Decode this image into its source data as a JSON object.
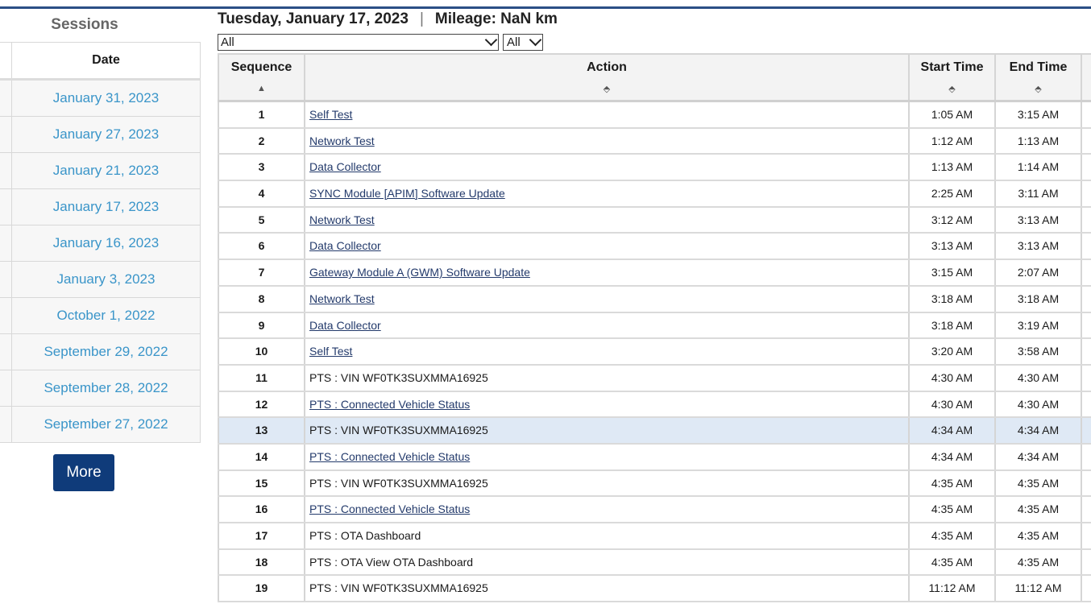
{
  "sessions": {
    "title": "Sessions",
    "date_header": "Date",
    "dates": [
      "January 31, 2023",
      "January 27, 2023",
      "January 21, 2023",
      "January 17, 2023",
      "January 16, 2023",
      "January 3, 2023",
      "October 1, 2022",
      "September 29, 2022",
      "September 28, 2022",
      "September 27, 2022"
    ],
    "more_label": "More"
  },
  "header": {
    "date": "Tuesday, January 17, 2023",
    "separator": "|",
    "mileage": "Mileage: NaN km"
  },
  "filters": {
    "action_filter": "All",
    "type_filter": "All"
  },
  "table": {
    "columns": {
      "sequence": "Sequence",
      "action": "Action",
      "start": "Start Time",
      "end": "End Time"
    },
    "sort_icons": {
      "sequence": "▲",
      "action": "⬘",
      "start": "⬘",
      "end": "⬘"
    },
    "rows": [
      {
        "seq": "1",
        "action": "Self Test",
        "link": true,
        "start": "1:05 AM",
        "end": "3:15 AM"
      },
      {
        "seq": "2",
        "action": "Network Test",
        "link": true,
        "start": "1:12 AM",
        "end": "1:13 AM"
      },
      {
        "seq": "3",
        "action": "Data Collector",
        "link": true,
        "start": "1:13 AM",
        "end": "1:14 AM"
      },
      {
        "seq": "4",
        "action": "SYNC Module [APIM] Software Update",
        "link": true,
        "start": "2:25 AM",
        "end": "3:11 AM"
      },
      {
        "seq": "5",
        "action": "Network Test",
        "link": true,
        "start": "3:12 AM",
        "end": "3:13 AM"
      },
      {
        "seq": "6",
        "action": "Data Collector",
        "link": true,
        "start": "3:13 AM",
        "end": "3:13 AM"
      },
      {
        "seq": "7",
        "action": "Gateway Module A (GWM) Software Update",
        "link": true,
        "start": "3:15 AM",
        "end": "2:07 AM"
      },
      {
        "seq": "8",
        "action": "Network Test",
        "link": true,
        "start": "3:18 AM",
        "end": "3:18 AM"
      },
      {
        "seq": "9",
        "action": "Data Collector",
        "link": true,
        "start": "3:18 AM",
        "end": "3:19 AM"
      },
      {
        "seq": "10",
        "action": "Self Test",
        "link": true,
        "start": "3:20 AM",
        "end": "3:58 AM"
      },
      {
        "seq": "11",
        "action": "PTS : VIN WF0TK3SUXMMA16925",
        "link": false,
        "start": "4:30 AM",
        "end": "4:30 AM"
      },
      {
        "seq": "12",
        "action": "PTS : Connected Vehicle Status",
        "link": true,
        "start": "4:30 AM",
        "end": "4:30 AM"
      },
      {
        "seq": "13",
        "action": "PTS : VIN WF0TK3SUXMMA16925",
        "link": false,
        "start": "4:34 AM",
        "end": "4:34 AM",
        "selected": true
      },
      {
        "seq": "14",
        "action": "PTS : Connected Vehicle Status",
        "link": true,
        "start": "4:34 AM",
        "end": "4:34 AM"
      },
      {
        "seq": "15",
        "action": "PTS : VIN WF0TK3SUXMMA16925",
        "link": false,
        "start": "4:35 AM",
        "end": "4:35 AM"
      },
      {
        "seq": "16",
        "action": "PTS : Connected Vehicle Status",
        "link": true,
        "start": "4:35 AM",
        "end": "4:35 AM"
      },
      {
        "seq": "17",
        "action": "PTS : OTA Dashboard",
        "link": false,
        "start": "4:35 AM",
        "end": "4:35 AM"
      },
      {
        "seq": "18",
        "action": "PTS : OTA View OTA Dashboard",
        "link": false,
        "start": "4:35 AM",
        "end": "4:35 AM"
      },
      {
        "seq": "19",
        "action": "PTS : VIN WF0TK3SUXMMA16925",
        "link": false,
        "start": "11:12 AM",
        "end": "11:12 AM"
      }
    ]
  },
  "colors": {
    "accent": "#0f3b7a",
    "link": "#3a95c9",
    "selected_row": "#dfe9f5"
  }
}
